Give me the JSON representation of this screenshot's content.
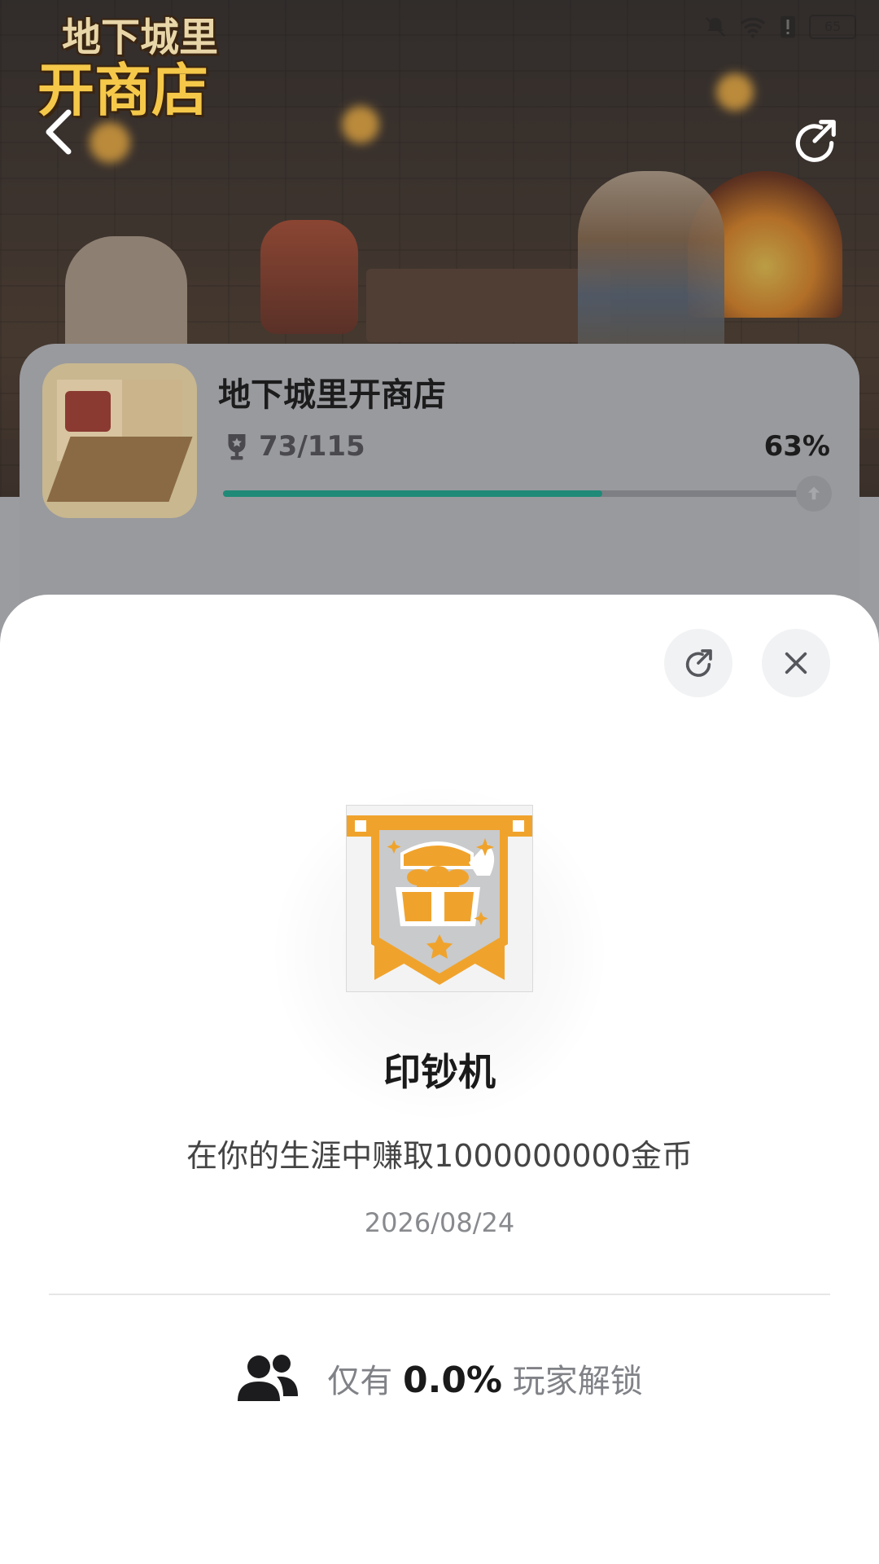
{
  "status_bar": {
    "battery": "65"
  },
  "header": {
    "logo_line1": "地下城里",
    "logo_line2": "开商店"
  },
  "game": {
    "title": "地下城里开商店",
    "trophies": "73/115",
    "progress_pct_label": "63%",
    "progress_fraction": 0.63
  },
  "achievement": {
    "title": "印钞机",
    "description": "在你的生涯中赚取1000000000金币",
    "date": "2026/08/24",
    "unlock_prefix": "仅有",
    "unlock_pct": "0.0%",
    "unlock_suffix": "玩家解锁"
  },
  "icons": {
    "back": "chevron-left-icon",
    "share": "share-icon",
    "close": "close-icon",
    "trophy": "trophy-icon",
    "players": "users-icon",
    "badge": "treasure-chest-icon"
  },
  "colors": {
    "accent": "#1f8a78",
    "badge_orange": "#f0a32c"
  }
}
